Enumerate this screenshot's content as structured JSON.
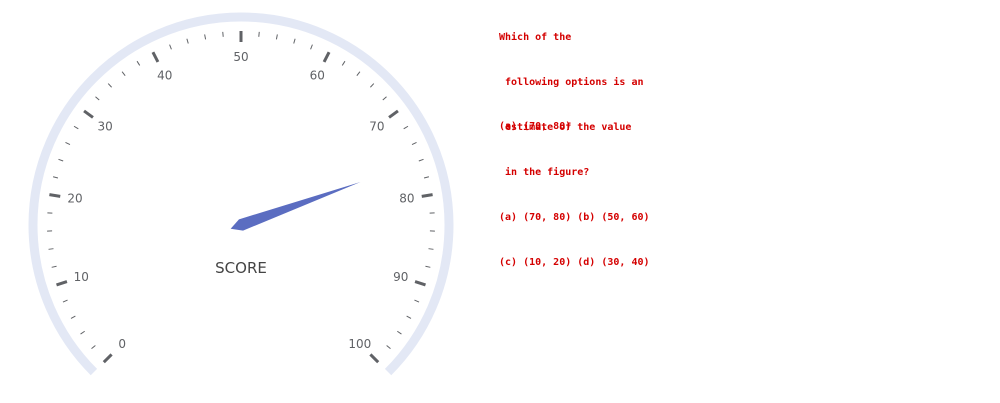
{
  "chart_data": {
    "type": "gauge",
    "title": "SCORE",
    "min": 0,
    "max": 100,
    "major_ticks": [
      0,
      10,
      20,
      30,
      40,
      50,
      60,
      70,
      80,
      90,
      100
    ],
    "tick_labels": [
      "0",
      "10",
      "20",
      "30",
      "40",
      "50",
      "60",
      "70",
      "80",
      "90",
      "100"
    ],
    "value": 76,
    "colors": {
      "track": "#e3e8f5",
      "pointer": "#5b6dc1",
      "tick": "#606266",
      "label": "#606266"
    }
  },
  "question": {
    "lines": [
      "Which of the",
      " following options is an",
      " estimate of the value",
      " in the figure?",
      "(a) (70, 80) (b) (50, 60)",
      "(c) (10, 20) (d) (30, 40)"
    ],
    "answer": "(a) (70, 80)",
    "color": "#d40000"
  }
}
